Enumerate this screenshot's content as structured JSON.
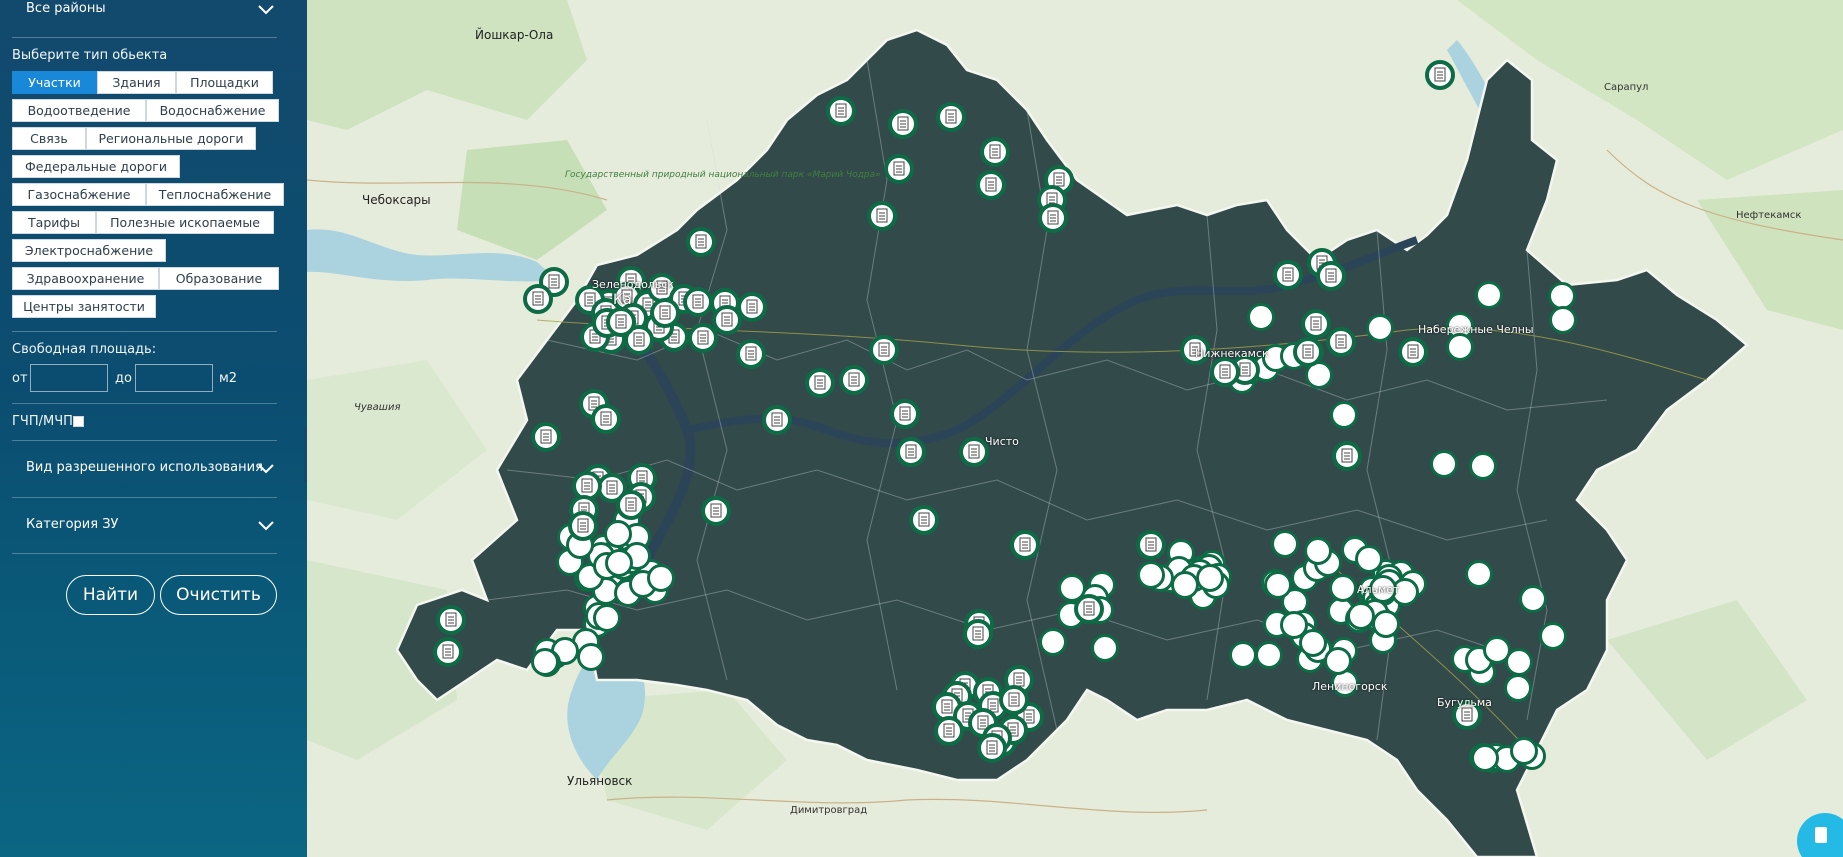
{
  "sidebar": {
    "district_dropdown": {
      "label": "Все районы"
    },
    "object_type": {
      "label": "Выберите тип обьекта",
      "chips": [
        {
          "label": "Участки",
          "active": true
        },
        {
          "label": "Здания",
          "active": false
        },
        {
          "label": "Площадки",
          "active": false
        },
        {
          "label": "Водоотведение",
          "active": false
        },
        {
          "label": "Водоснабжение",
          "active": false
        },
        {
          "label": "Связь",
          "active": false
        },
        {
          "label": "Региональные дороги",
          "active": false
        },
        {
          "label": "Федеральные дороги",
          "active": false
        },
        {
          "label": "Газоснабжение",
          "active": false
        },
        {
          "label": "Теплоснабжение",
          "active": false
        },
        {
          "label": "Тарифы",
          "active": false
        },
        {
          "label": "Полезные ископаемые",
          "active": false
        },
        {
          "label": "Электроснабжение",
          "active": false
        },
        {
          "label": "Здравоохранение",
          "active": false
        },
        {
          "label": "Образование",
          "active": false
        },
        {
          "label": "Центры занятости",
          "active": false
        }
      ]
    },
    "free_area": {
      "label": "Свободная площадь:",
      "from_label": "от",
      "to_label": "до",
      "unit": "м2",
      "from_value": "",
      "to_value": ""
    },
    "gchp": {
      "label": "ГЧП/МЧП",
      "checked": false
    },
    "permitted_use_dropdown": {
      "label": "Вид разрешенного использования"
    },
    "land_category_dropdown": {
      "label": "Категория ЗУ"
    },
    "buttons": {
      "find": "Найти",
      "clear": "Очистить"
    }
  },
  "map": {
    "labels": {
      "yoshkar_ola": "Йошкар-Ола",
      "cheboksary": "Чебоксары",
      "park": "Государственный природный национальный парк «Марий Чодра»",
      "sarapul": "Сарапул",
      "neftekamsk": "Нефтекамск",
      "chuvashia": "Чувашия",
      "ulyanovsk": "Ульяновск",
      "dimitrovgrad": "Димитровград",
      "naberezhnye_chelny": "Набережные Челны",
      "nizhnekamsk": "Нижнекамск",
      "chistopol": "Чисто",
      "kazan": "Ка",
      "zelenodolsk": "Зеленодольск",
      "leninogorsk": "Лениногорск",
      "bugulma": "Бугульма",
      "almetyevsk": "Альмет"
    },
    "colors": {
      "region_fill": "#334a4a",
      "marker_ring": "#0d6b45",
      "marker_fill": "#ffffff",
      "sidebar_bg": "#0e4f70",
      "active_chip": "#1a88d8"
    },
    "marker_types": [
      "document-marker",
      "plain-marker"
    ]
  }
}
